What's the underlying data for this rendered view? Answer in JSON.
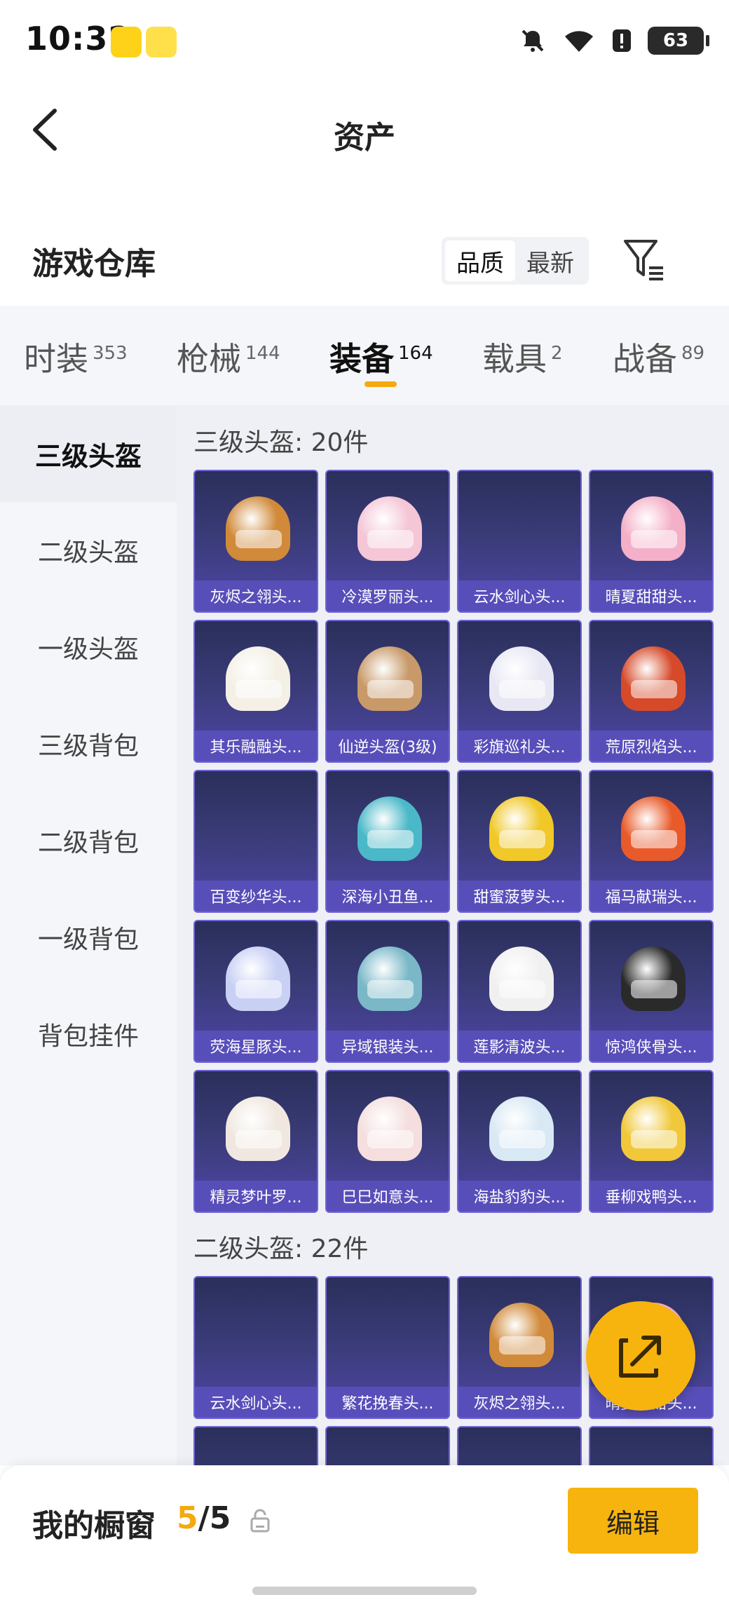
{
  "status_bar": {
    "time": "10:32",
    "battery": "63"
  },
  "header": {
    "title": "资产"
  },
  "section": {
    "title": "游戏仓库",
    "sort_options": [
      "品质",
      "最新"
    ],
    "active_sort": "品质"
  },
  "tabs": [
    {
      "label": "时装",
      "count": "353"
    },
    {
      "label": "枪械",
      "count": "144"
    },
    {
      "label": "装备",
      "count": "164"
    },
    {
      "label": "载具",
      "count": "2"
    },
    {
      "label": "战备",
      "count": "89"
    }
  ],
  "active_tab": "装备",
  "sidebar": {
    "items": [
      "三级头盔",
      "二级头盔",
      "一级头盔",
      "三级背包",
      "二级背包",
      "一级背包",
      "背包挂件"
    ],
    "active": "三级头盔"
  },
  "groups": [
    {
      "title": "三级头盔: 20件",
      "items": [
        "灰烬之翎头...",
        "冷漠罗丽头...",
        "云水剑心头...",
        "晴夏甜甜头...",
        "其乐融融头...",
        "仙逆头盔(3级)",
        "彩旗巡礼头...",
        "荒原烈焰头...",
        "百变纱华头...",
        "深海小丑鱼...",
        "甜蜜菠萝头...",
        "福马献瑞头...",
        "荧海星豚头...",
        "异域银装头...",
        "莲影清波头...",
        "惊鸿侠骨头...",
        "精灵梦叶罗...",
        "巳巳如意头...",
        "海盐豹豹头...",
        "垂柳戏鸭头..."
      ]
    },
    {
      "title": "二级头盔: 22件",
      "items": [
        "云水剑心头...",
        "繁花挽春头...",
        "灰烬之翎头...",
        "晴夏甜甜头..."
      ]
    }
  ],
  "item_colors": [
    "#d08a3a",
    "#f4c6d6",
    "",
    "#f4b0c8",
    "#f4f0e6",
    "#c89a6a",
    "#e8e8f4",
    "#d64a2a",
    "",
    "#4ab8c8",
    "#f0c828",
    "#e85a2a",
    "#c8d0f4",
    "#7ab8c8",
    "#f0f0f0",
    "#2a2a2a",
    "#f0e8e0",
    "#f4dede",
    "#d8e8f4",
    "#f0c83a"
  ],
  "group2_colors": [
    "",
    "",
    "#d08a3a",
    "#f4b0c8"
  ],
  "bottom": {
    "showcase_label": "我的橱窗",
    "current": "5",
    "separator": "/",
    "total": "5",
    "edit_label": "编辑"
  },
  "colors": {
    "accent": "#f7b40e",
    "card_border": "#6f64d6"
  }
}
